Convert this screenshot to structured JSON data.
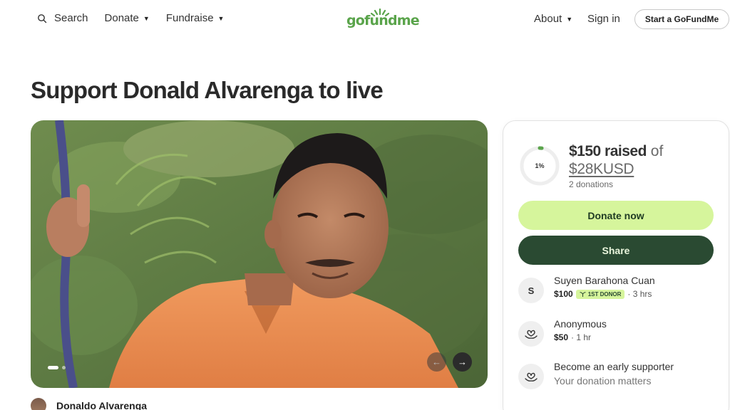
{
  "header": {
    "search_label": "Search",
    "donate_label": "Donate",
    "fundraise_label": "Fundraise",
    "logo_text": "gofundme",
    "about_label": "About",
    "signin_label": "Sign in",
    "start_label": "Start a GoFundMe"
  },
  "page": {
    "title": "Support Donald Alvarenga to live"
  },
  "hero": {
    "prev_icon": "←",
    "next_icon": "→"
  },
  "organizer": {
    "name": "Donaldo Alvarenga"
  },
  "card": {
    "progress_percent": 1,
    "progress_label": "1%",
    "raised_amount": "$150 raised",
    "raised_of": "of",
    "goal": "$28KUSD",
    "donation_count": "2 donations",
    "donate_button": "Donate now",
    "share_button": "Share",
    "donors": [
      {
        "initial": "S",
        "name": "Suyen Barahona Cuan",
        "amount": "$100",
        "badge": "1ST DONOR",
        "time": "· 3 hrs"
      },
      {
        "name": "Anonymous",
        "amount": "$50",
        "time": "· 1 hr"
      }
    ],
    "early": {
      "title": "Become an early supporter",
      "subtitle": "Your donation matters"
    }
  },
  "colors": {
    "brand": "#5aa44b",
    "donate_button": "#d6f59c",
    "share_button": "#2a4a32"
  }
}
